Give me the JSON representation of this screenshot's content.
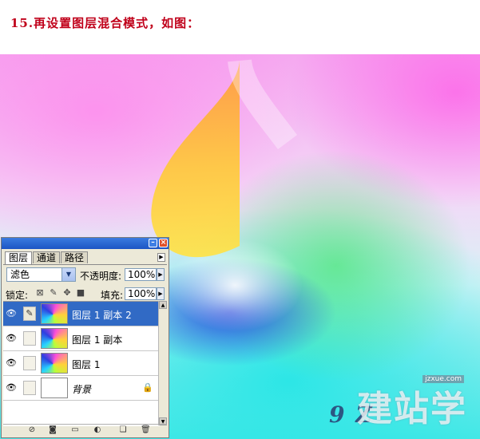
{
  "caption": "15.再设置图层混合模式，如图：",
  "watermark": {
    "site_text": "建站学",
    "site_small": "jzxue.com",
    "logo_text": "9 Z"
  },
  "layers_panel": {
    "tabs": [
      "图层",
      "通道",
      "路径"
    ],
    "active_tab": "图层",
    "blend_mode": "滤色",
    "opacity_label": "不透明度:",
    "opacity_value": "100%",
    "lock_label": "锁定:",
    "fill_label": "填充:",
    "fill_value": "100%",
    "layers": [
      {
        "name": "图层 1 副本 2",
        "selected": true,
        "thumb": "swirl",
        "eye": "eye-icon"
      },
      {
        "name": "图层 1 副本",
        "selected": false,
        "thumb": "swirl",
        "eye": "eye-icon"
      },
      {
        "name": "图层 1",
        "selected": false,
        "thumb": "swirl",
        "eye": "eye-icon"
      },
      {
        "name": "背景",
        "selected": false,
        "thumb": "white",
        "eye": "eye-icon",
        "locked": true
      }
    ]
  },
  "colors": {
    "caption": "#c0001a",
    "titlebar": "#1d55c4",
    "selection": "#316ac5",
    "panel_bg": "#ece9d8"
  }
}
